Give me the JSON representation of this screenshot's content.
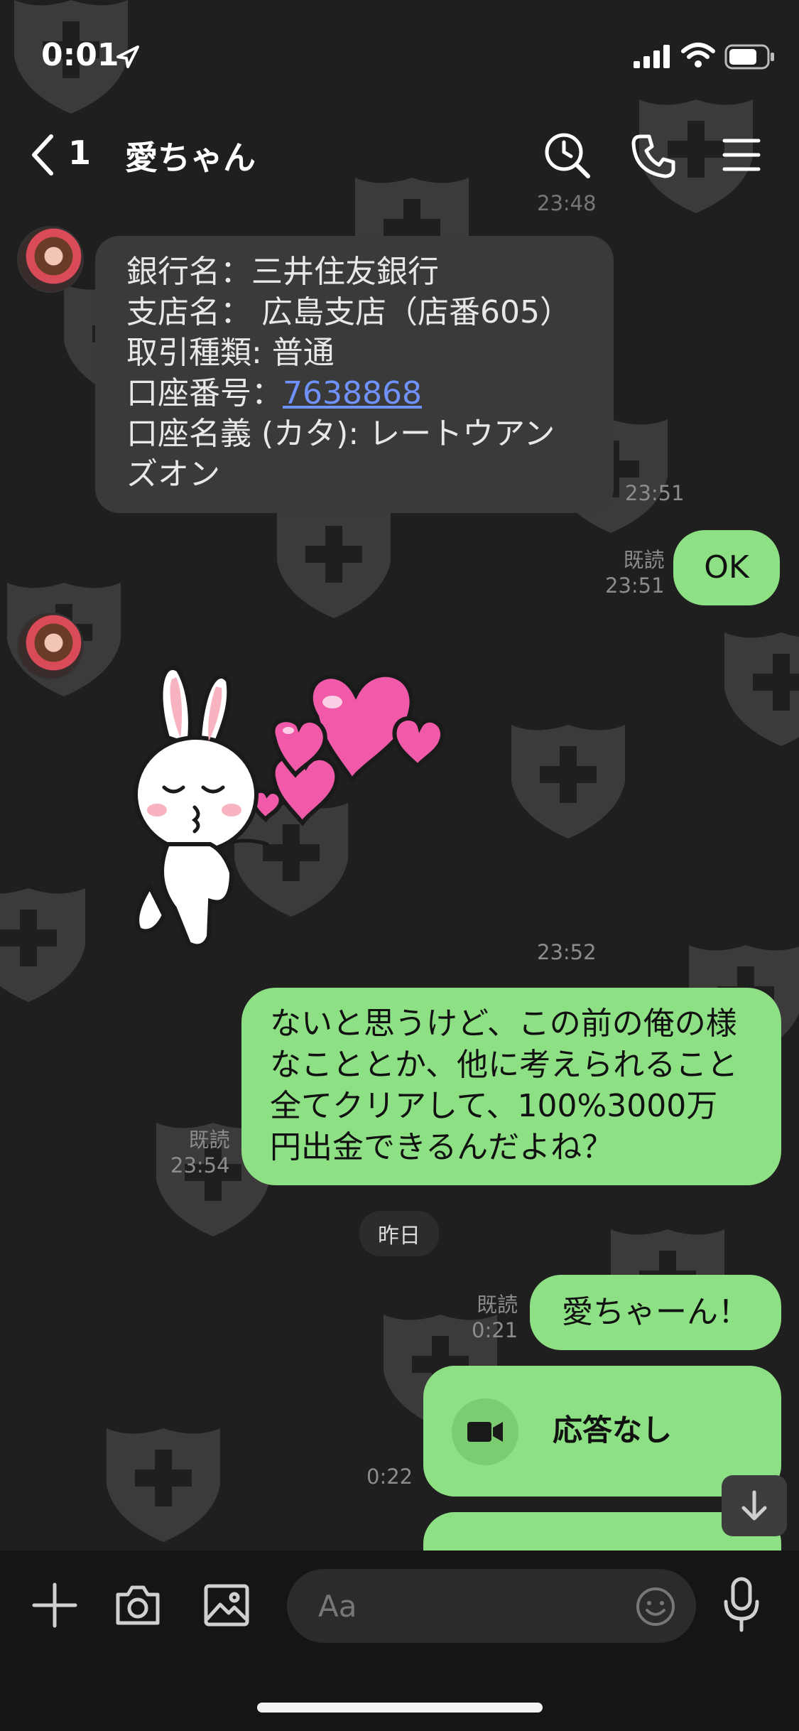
{
  "status_bar": {
    "time": "0:01"
  },
  "header": {
    "back_count": "1",
    "title": "愛ちゃん"
  },
  "messages": {
    "prev_time": "23:48",
    "bank": {
      "line1": "銀行名：三井住友銀行",
      "line2": "支店名： 広島支店（店番605）",
      "line3": "取引種類: 普通",
      "line4_label": "口座番号：",
      "line4_number": "7638868",
      "line5": "口座名義 (カタ): レートウアン",
      "line6": "ズオン",
      "time": "23:51"
    },
    "ok": {
      "text": "OK",
      "read": "既読",
      "time": "23:51"
    },
    "sticker": {
      "time": "23:52"
    },
    "long": {
      "line1": "ないと思うけど、この前の俺の様",
      "line2": "なこととか、他に考えられること",
      "line3": "全てクリアして、100%3000万",
      "line4": "円出金できるんだよね？",
      "read": "既読",
      "time": "23:54"
    },
    "date_divider": "昨日",
    "ai": {
      "text": "愛ちゃーん！",
      "read": "既読",
      "time": "0:21"
    },
    "call": {
      "text": "応答なし",
      "time": "0:22"
    }
  },
  "input": {
    "placeholder": "Aa"
  },
  "colors": {
    "outgoing": "#8ee084",
    "incoming": "#3a3a3a",
    "background": "#1f1f1f",
    "link": "#6f92ff"
  }
}
